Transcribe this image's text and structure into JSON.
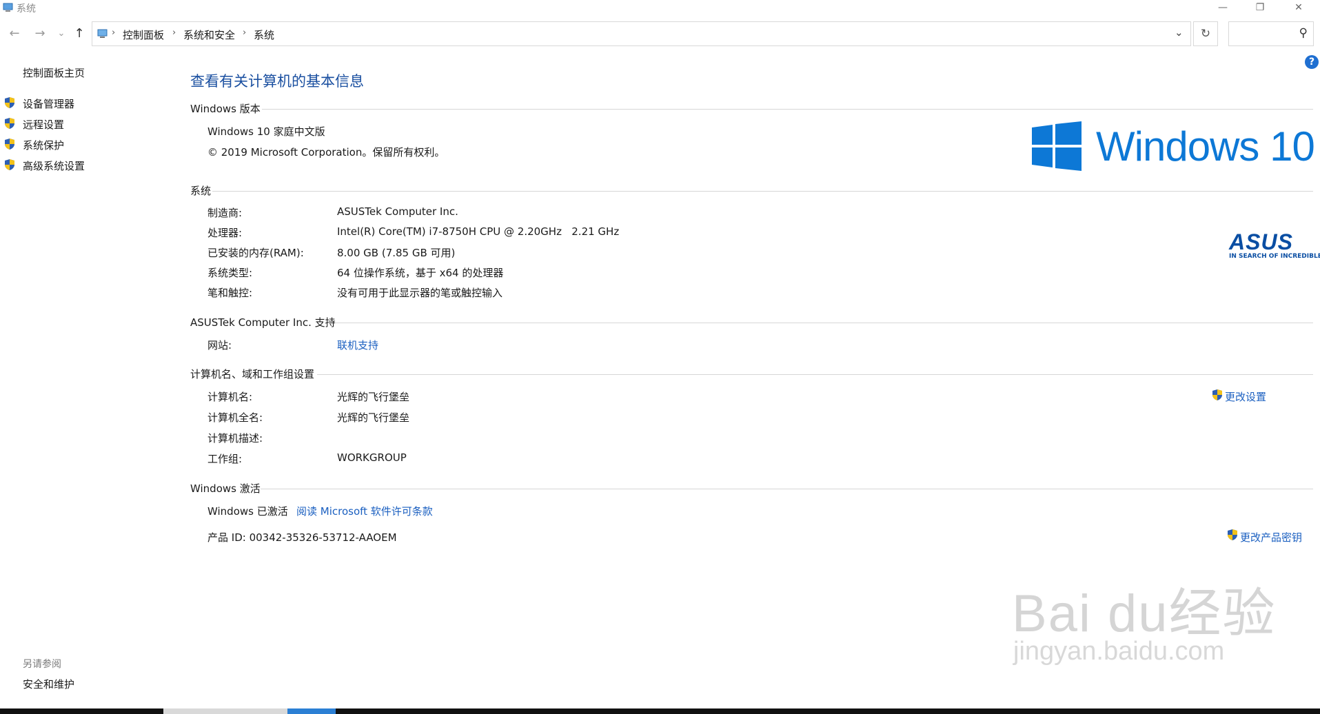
{
  "window": {
    "title": "系统",
    "minimize": "—",
    "restore": "❐",
    "close": "✕"
  },
  "nav": {
    "back": "←",
    "forward": "→",
    "recent": "⌄",
    "up": "↑"
  },
  "address": {
    "crumbs": [
      "控制面板",
      "系统和安全",
      "系统"
    ],
    "sep": "›",
    "dropdown": "⌄",
    "refresh": "↻",
    "search_icon": "⚲"
  },
  "help": "?",
  "left_pane": {
    "home": "控制面板主页",
    "links": [
      "设备管理器",
      "远程设置",
      "系统保护",
      "高级系统设置"
    ],
    "see_also_title": "另请参阅",
    "see_also": [
      "安全和维护"
    ]
  },
  "main": {
    "heading": "查看有关计算机的基本信息",
    "edition": {
      "section": "Windows 版本",
      "name": "Windows 10 家庭中文版",
      "copyright": "© 2019 Microsoft Corporation。保留所有权利。"
    },
    "windows_logo_text": "Windows 10",
    "system": {
      "section": "系统",
      "rows": [
        {
          "label": "制造商:",
          "value": "ASUSTek Computer Inc."
        },
        {
          "label": "处理器:",
          "value": "Intel(R) Core(TM) i7-8750H CPU @ 2.20GHz   2.21 GHz"
        },
        {
          "label": "已安装的内存(RAM):",
          "value": "8.00 GB (7.85 GB 可用)"
        },
        {
          "label": "系统类型:",
          "value": "64 位操作系统，基于 x64 的处理器"
        },
        {
          "label": "笔和触控:",
          "value": "没有可用于此显示器的笔或触控输入"
        }
      ]
    },
    "asus_logo": {
      "brand": "ASUS",
      "tagline": "IN SEARCH OF INCREDIBLE"
    },
    "support": {
      "section": "ASUSTek Computer Inc. 支持",
      "label": "网站:",
      "link": "联机支持"
    },
    "computer": {
      "section": "计算机名、域和工作组设置",
      "change_link": "更改设置",
      "rows": [
        {
          "label": "计算机名:",
          "value": "光辉的飞行堡垒"
        },
        {
          "label": "计算机全名:",
          "value": "光辉的飞行堡垒"
        },
        {
          "label": "计算机描述:",
          "value": ""
        },
        {
          "label": "工作组:",
          "value": "WORKGROUP"
        }
      ]
    },
    "activation": {
      "section": "Windows 激活",
      "status": "Windows 已激活",
      "license_link": "阅读 Microsoft 软件许可条款",
      "product_id": "产品 ID: 00342-35326-53712-AAOEM",
      "change_key_link": "更改产品密钥"
    }
  },
  "watermark": {
    "big": "Bai du经验",
    "small": "jingyan.baidu.com"
  },
  "colors": {
    "accent": "#1a5fc0",
    "heading": "#1a4fa0",
    "windows_blue": "#0d78d6",
    "asus_blue": "#0a4ea3"
  }
}
